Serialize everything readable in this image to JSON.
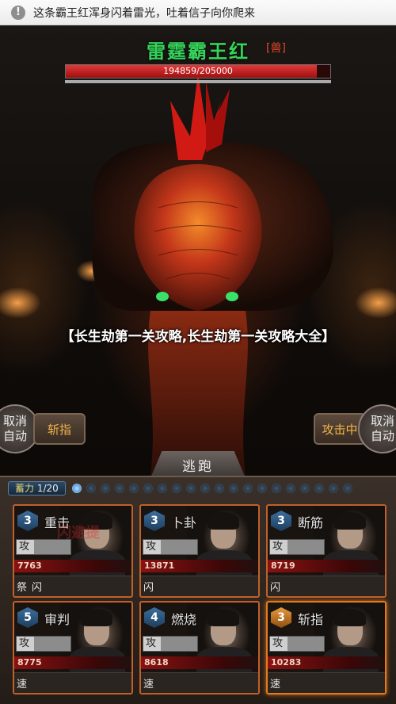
{
  "notification": {
    "icon": "info-icon",
    "icon_glyph": "!",
    "text": "这条霸王红浑身闪着雷光，吐着信子向你爬来"
  },
  "boss": {
    "name": "雷霆霸王红",
    "tag": "[兽]",
    "hp_text": "194859/205000",
    "hp_current": 194859,
    "hp_max": 205000
  },
  "overlay_title": "【长生劫第一关攻略,长生劫第一关攻略大全】",
  "controls": {
    "cancel_auto": "取消\n自动",
    "slash_finger": "斩指",
    "attacking": "攻击中",
    "cancel_auto_right": "取消\n自动",
    "flee": "逃跑"
  },
  "power": {
    "label": "蓄力",
    "value": "1/20",
    "total": 20,
    "filled": 1
  },
  "cards": [
    {
      "level": "3",
      "skill": "重击",
      "atk_label": "攻",
      "hp": "7763",
      "tags": [
        "祭",
        "闪"
      ],
      "ghost": "闪避提"
    },
    {
      "level": "3",
      "skill": "卜卦",
      "atk_label": "攻",
      "hp": "13871",
      "tags": [
        "闪"
      ]
    },
    {
      "level": "3",
      "skill": "断筋",
      "atk_label": "攻",
      "hp": "8719",
      "tags": [
        "闪"
      ]
    },
    {
      "level": "5",
      "skill": "审判",
      "atk_label": "攻",
      "hp": "8775",
      "tags": [
        "速"
      ]
    },
    {
      "level": "4",
      "skill": "燃烧",
      "atk_label": "攻",
      "hp": "8618",
      "tags": [
        "速"
      ]
    },
    {
      "level": "3",
      "skill": "斩指",
      "atk_label": "攻",
      "hp": "10283",
      "tags": [
        "速"
      ],
      "highlight": true
    }
  ]
}
